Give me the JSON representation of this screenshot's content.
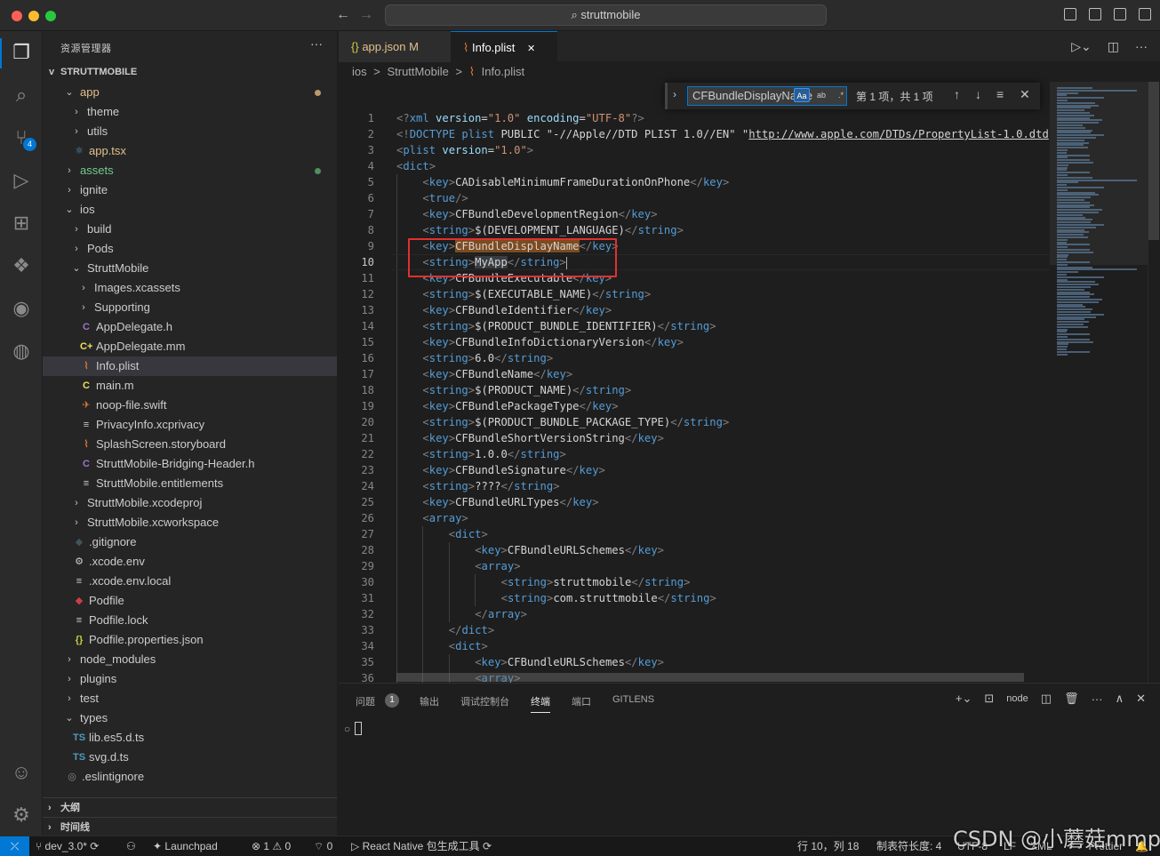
{
  "window": {
    "search_text": "struttmobile"
  },
  "sidebar": {
    "title": "资源管理器",
    "more": "···",
    "root_label": "STRUTTMOBILE",
    "tree": [
      {
        "label": "app",
        "chev": "v",
        "icon": "",
        "level": 1,
        "color": "#e2c08d",
        "dot": "#b89a6d"
      },
      {
        "label": "theme",
        "chev": ">",
        "icon": "",
        "level": 2,
        "color": "#cccccc"
      },
      {
        "label": "utils",
        "chev": ">",
        "icon": "",
        "level": 2,
        "color": "#cccccc"
      },
      {
        "label": "app.tsx",
        "chev": "",
        "icon": "⚛",
        "iconColor": "#519aba",
        "level": 2,
        "color": "#e2c08d"
      },
      {
        "label": "assets",
        "chev": ">",
        "icon": "",
        "level": 1,
        "color": "#73c991",
        "dot": "#4e8f5e"
      },
      {
        "label": "ignite",
        "chev": ">",
        "icon": "",
        "level": 1,
        "color": "#cccccc"
      },
      {
        "label": "ios",
        "chev": "v",
        "icon": "",
        "level": 1,
        "color": "#cccccc"
      },
      {
        "label": "build",
        "chev": ">",
        "icon": "",
        "level": 2,
        "color": "#cccccc"
      },
      {
        "label": "Pods",
        "chev": ">",
        "icon": "",
        "level": 2,
        "color": "#cccccc"
      },
      {
        "label": "StruttMobile",
        "chev": "v",
        "icon": "",
        "level": 2,
        "color": "#cccccc"
      },
      {
        "label": "Images.xcassets",
        "chev": ">",
        "icon": "",
        "level": 3,
        "color": "#cccccc"
      },
      {
        "label": "Supporting",
        "chev": ">",
        "icon": "",
        "level": 3,
        "color": "#cccccc"
      },
      {
        "label": "AppDelegate.h",
        "chev": "",
        "icon": "C",
        "iconColor": "#a074c4",
        "level": 3,
        "color": "#cccccc"
      },
      {
        "label": "AppDelegate.mm",
        "chev": "",
        "icon": "C+",
        "iconColor": "#f1e05a",
        "level": 3,
        "color": "#cccccc"
      },
      {
        "label": "Info.plist",
        "chev": "",
        "icon": "⌇",
        "iconColor": "#e37933",
        "level": 3,
        "color": "#cccccc",
        "selected": true
      },
      {
        "label": "main.m",
        "chev": "",
        "icon": "C",
        "iconColor": "#f1e05a",
        "level": 3,
        "color": "#cccccc"
      },
      {
        "label": "noop-file.swift",
        "chev": "",
        "icon": "✈",
        "iconColor": "#e37933",
        "level": 3,
        "color": "#cccccc"
      },
      {
        "label": "PrivacyInfo.xcprivacy",
        "chev": "",
        "icon": "≡",
        "iconColor": "#cccccc",
        "level": 3,
        "color": "#cccccc"
      },
      {
        "label": "SplashScreen.storyboard",
        "chev": "",
        "icon": "⌇",
        "iconColor": "#e37933",
        "level": 3,
        "color": "#cccccc"
      },
      {
        "label": "StruttMobile-Bridging-Header.h",
        "chev": "",
        "icon": "C",
        "iconColor": "#a074c4",
        "level": 3,
        "color": "#cccccc"
      },
      {
        "label": "StruttMobile.entitlements",
        "chev": "",
        "icon": "≡",
        "iconColor": "#cccccc",
        "level": 3,
        "color": "#cccccc"
      },
      {
        "label": "StruttMobile.xcodeproj",
        "chev": ">",
        "icon": "",
        "level": 2,
        "color": "#cccccc"
      },
      {
        "label": "StruttMobile.xcworkspace",
        "chev": ">",
        "icon": "",
        "level": 2,
        "color": "#cccccc"
      },
      {
        "label": ".gitignore",
        "chev": "",
        "icon": "◆",
        "iconColor": "#41535b",
        "level": 2,
        "color": "#cccccc"
      },
      {
        "label": ".xcode.env",
        "chev": "",
        "icon": "⚙",
        "iconColor": "#cccccc",
        "level": 2,
        "color": "#cccccc"
      },
      {
        "label": ".xcode.env.local",
        "chev": "",
        "icon": "≡",
        "iconColor": "#cccccc",
        "level": 2,
        "color": "#cccccc"
      },
      {
        "label": "Podfile",
        "chev": "",
        "icon": "◆",
        "iconColor": "#cc3e44",
        "level": 2,
        "color": "#cccccc"
      },
      {
        "label": "Podfile.lock",
        "chev": "",
        "icon": "≡",
        "iconColor": "#cccccc",
        "level": 2,
        "color": "#cccccc"
      },
      {
        "label": "Podfile.properties.json",
        "chev": "",
        "icon": "{}",
        "iconColor": "#cbcb41",
        "level": 2,
        "color": "#cccccc"
      },
      {
        "label": "node_modules",
        "chev": ">",
        "icon": "",
        "level": 1,
        "color": "#cccccc"
      },
      {
        "label": "plugins",
        "chev": ">",
        "icon": "",
        "level": 1,
        "color": "#cccccc"
      },
      {
        "label": "test",
        "chev": ">",
        "icon": "",
        "level": 1,
        "color": "#cccccc"
      },
      {
        "label": "types",
        "chev": "v",
        "icon": "",
        "level": 1,
        "color": "#cccccc"
      },
      {
        "label": "lib.es5.d.ts",
        "chev": "",
        "icon": "TS",
        "iconColor": "#519aba",
        "level": 2,
        "color": "#cccccc"
      },
      {
        "label": "svg.d.ts",
        "chev": "",
        "icon": "TS",
        "iconColor": "#519aba",
        "level": 2,
        "color": "#cccccc"
      },
      {
        "label": ".eslintignore",
        "chev": "",
        "icon": "◎",
        "iconColor": "#8a8a8a",
        "level": 1,
        "color": "#cccccc"
      }
    ],
    "outline_label": "大纲",
    "timeline_label": "时间线"
  },
  "tabs": [
    {
      "icon": "{}",
      "label": "app.json",
      "modified": "M",
      "active": false
    },
    {
      "icon": "⌇",
      "label": "Info.plist",
      "close": "✕",
      "active": true
    }
  ],
  "breadcrumb": [
    "ios",
    ">",
    "StruttMobile",
    ">",
    "Info.plist"
  ],
  "find": {
    "query": "CFBundleDisplayName",
    "opt_case": "Aa",
    "opt_word": "ab",
    "opt_regex": ".*",
    "result": "第 1 项，共 1 项"
  },
  "editor": {
    "current_line": 10,
    "lines": [
      {
        "n": 1,
        "indent": 0,
        "html": "<span class='brk'>&lt;?</span><span class='tag'>xml</span> <span class='attr'>version</span>=<span class='str'>\"1.0\"</span> <span class='attr'>encoding</span>=<span class='str'>\"UTF-8\"</span><span class='brk'>?&gt;</span>"
      },
      {
        "n": 2,
        "indent": 0,
        "html": "<span class='brk'>&lt;!</span><span class='tag'>DOCTYPE</span> <span class='tag'>plist</span> <span class='txt'>PUBLIC \"-//Apple//DTD PLIST 1.0//EN\" \"<span class='link'>http://www.apple.com/DTDs/PropertyList-1.0.dtd</span>\"</span><span class='brk'>&gt;</span>"
      },
      {
        "n": 3,
        "indent": 0,
        "html": "<span class='brk'>&lt;</span><span class='tag'>plist</span> <span class='attr'>version</span>=<span class='str'>\"1.0\"</span><span class='brk'>&gt;</span>"
      },
      {
        "n": 4,
        "indent": 0,
        "html": "<span class='brk'>&lt;</span><span class='tag'>dict</span><span class='brk'>&gt;</span>"
      },
      {
        "n": 5,
        "indent": 1,
        "html": "<span class='brk'>&lt;</span><span class='tag'>key</span><span class='brk'>&gt;</span>CADisableMinimumFrameDurationOnPhone<span class='brk'>&lt;/</span><span class='tag'>key</span><span class='brk'>&gt;</span>"
      },
      {
        "n": 6,
        "indent": 1,
        "html": "<span class='brk'>&lt;</span><span class='tag'>true</span><span class='brk'>/&gt;</span>"
      },
      {
        "n": 7,
        "indent": 1,
        "html": "<span class='brk'>&lt;</span><span class='tag'>key</span><span class='brk'>&gt;</span>CFBundleDevelopmentRegion<span class='brk'>&lt;/</span><span class='tag'>key</span><span class='brk'>&gt;</span>"
      },
      {
        "n": 8,
        "indent": 1,
        "html": "<span class='brk'>&lt;</span><span class='tag'>string</span><span class='brk'>&gt;</span>$(DEVELOPMENT_LANGUAGE)<span class='brk'>&lt;/</span><span class='tag'>string</span><span class='brk'>&gt;</span>"
      },
      {
        "n": 9,
        "indent": 1,
        "html": "<span class='brk'>&lt;</span><span class='tag'>key</span><span class='brk'>&gt;</span><span class='hl-find'>CFBundleDisplayName</span><span class='brk'>&lt;/</span><span class='tag'>key</span><span class='brk'>&gt;</span>"
      },
      {
        "n": 10,
        "indent": 1,
        "html": "<span class='brk'>&lt;</span><span class='tag'>string</span><span class='brk'>&gt;</span><span class='hl-sel'>MyApp</span><span class='brk'>&lt;/</span><span class='tag'>string</span><span class='brk'>&gt;</span><span class='cursor'></span>"
      },
      {
        "n": 11,
        "indent": 1,
        "html": "<span class='brk'>&lt;</span><span class='tag'>key</span><span class='brk'>&gt;</span>CFBundleExecutable<span class='brk'>&lt;/</span><span class='tag'>key</span><span class='brk'>&gt;</span>"
      },
      {
        "n": 12,
        "indent": 1,
        "html": "<span class='brk'>&lt;</span><span class='tag'>string</span><span class='brk'>&gt;</span>$(EXECUTABLE_NAME)<span class='brk'>&lt;/</span><span class='tag'>string</span><span class='brk'>&gt;</span>"
      },
      {
        "n": 13,
        "indent": 1,
        "html": "<span class='brk'>&lt;</span><span class='tag'>key</span><span class='brk'>&gt;</span>CFBundleIdentifier<span class='brk'>&lt;/</span><span class='tag'>key</span><span class='brk'>&gt;</span>"
      },
      {
        "n": 14,
        "indent": 1,
        "html": "<span class='brk'>&lt;</span><span class='tag'>string</span><span class='brk'>&gt;</span>$(PRODUCT_BUNDLE_IDENTIFIER)<span class='brk'>&lt;/</span><span class='tag'>string</span><span class='brk'>&gt;</span>"
      },
      {
        "n": 15,
        "indent": 1,
        "html": "<span class='brk'>&lt;</span><span class='tag'>key</span><span class='brk'>&gt;</span>CFBundleInfoDictionaryVersion<span class='brk'>&lt;/</span><span class='tag'>key</span><span class='brk'>&gt;</span>"
      },
      {
        "n": 16,
        "indent": 1,
        "html": "<span class='brk'>&lt;</span><span class='tag'>string</span><span class='brk'>&gt;</span>6.0<span class='brk'>&lt;/</span><span class='tag'>string</span><span class='brk'>&gt;</span>"
      },
      {
        "n": 17,
        "indent": 1,
        "html": "<span class='brk'>&lt;</span><span class='tag'>key</span><span class='brk'>&gt;</span>CFBundleName<span class='brk'>&lt;/</span><span class='tag'>key</span><span class='brk'>&gt;</span>"
      },
      {
        "n": 18,
        "indent": 1,
        "html": "<span class='brk'>&lt;</span><span class='tag'>string</span><span class='brk'>&gt;</span>$(PRODUCT_NAME)<span class='brk'>&lt;/</span><span class='tag'>string</span><span class='brk'>&gt;</span>"
      },
      {
        "n": 19,
        "indent": 1,
        "html": "<span class='brk'>&lt;</span><span class='tag'>key</span><span class='brk'>&gt;</span>CFBundlePackageType<span class='brk'>&lt;/</span><span class='tag'>key</span><span class='brk'>&gt;</span>"
      },
      {
        "n": 20,
        "indent": 1,
        "html": "<span class='brk'>&lt;</span><span class='tag'>string</span><span class='brk'>&gt;</span>$(PRODUCT_BUNDLE_PACKAGE_TYPE)<span class='brk'>&lt;/</span><span class='tag'>string</span><span class='brk'>&gt;</span>"
      },
      {
        "n": 21,
        "indent": 1,
        "html": "<span class='brk'>&lt;</span><span class='tag'>key</span><span class='brk'>&gt;</span>CFBundleShortVersionString<span class='brk'>&lt;/</span><span class='tag'>key</span><span class='brk'>&gt;</span>"
      },
      {
        "n": 22,
        "indent": 1,
        "html": "<span class='brk'>&lt;</span><span class='tag'>string</span><span class='brk'>&gt;</span>1.0.0<span class='brk'>&lt;/</span><span class='tag'>string</span><span class='brk'>&gt;</span>"
      },
      {
        "n": 23,
        "indent": 1,
        "html": "<span class='brk'>&lt;</span><span class='tag'>key</span><span class='brk'>&gt;</span>CFBundleSignature<span class='brk'>&lt;/</span><span class='tag'>key</span><span class='brk'>&gt;</span>"
      },
      {
        "n": 24,
        "indent": 1,
        "html": "<span class='brk'>&lt;</span><span class='tag'>string</span><span class='brk'>&gt;</span>????<span class='brk'>&lt;/</span><span class='tag'>string</span><span class='brk'>&gt;</span>"
      },
      {
        "n": 25,
        "indent": 1,
        "html": "<span class='brk'>&lt;</span><span class='tag'>key</span><span class='brk'>&gt;</span>CFBundleURLTypes<span class='brk'>&lt;/</span><span class='tag'>key</span><span class='brk'>&gt;</span>"
      },
      {
        "n": 26,
        "indent": 1,
        "html": "<span class='brk'>&lt;</span><span class='tag'>array</span><span class='brk'>&gt;</span>"
      },
      {
        "n": 27,
        "indent": 2,
        "html": "<span class='brk'>&lt;</span><span class='tag'>dict</span><span class='brk'>&gt;</span>"
      },
      {
        "n": 28,
        "indent": 3,
        "html": "<span class='brk'>&lt;</span><span class='tag'>key</span><span class='brk'>&gt;</span>CFBundleURLSchemes<span class='brk'>&lt;/</span><span class='tag'>key</span><span class='brk'>&gt;</span>"
      },
      {
        "n": 29,
        "indent": 3,
        "html": "<span class='brk'>&lt;</span><span class='tag'>array</span><span class='brk'>&gt;</span>"
      },
      {
        "n": 30,
        "indent": 4,
        "html": "<span class='brk'>&lt;</span><span class='tag'>string</span><span class='brk'>&gt;</span>struttmobile<span class='brk'>&lt;/</span><span class='tag'>string</span><span class='brk'>&gt;</span>"
      },
      {
        "n": 31,
        "indent": 4,
        "html": "<span class='brk'>&lt;</span><span class='tag'>string</span><span class='brk'>&gt;</span>com.struttmobile<span class='brk'>&lt;/</span><span class='tag'>string</span><span class='brk'>&gt;</span>"
      },
      {
        "n": 32,
        "indent": 3,
        "html": "<span class='brk'>&lt;/</span><span class='tag'>array</span><span class='brk'>&gt;</span>"
      },
      {
        "n": 33,
        "indent": 2,
        "html": "<span class='brk'>&lt;/</span><span class='tag'>dict</span><span class='brk'>&gt;</span>"
      },
      {
        "n": 34,
        "indent": 2,
        "html": "<span class='brk'>&lt;</span><span class='tag'>dict</span><span class='brk'>&gt;</span>"
      },
      {
        "n": 35,
        "indent": 3,
        "html": "<span class='brk'>&lt;</span><span class='tag'>key</span><span class='brk'>&gt;</span>CFBundleURLSchemes<span class='brk'>&lt;/</span><span class='tag'>key</span><span class='brk'>&gt;</span>"
      },
      {
        "n": 36,
        "indent": 3,
        "html": "<span class='brk'>&lt;</span><span class='tag'>array</span><span class='brk'>&gt;</span>"
      }
    ]
  },
  "panel": {
    "tabs": [
      "问题",
      "输出",
      "调试控制台",
      "终端",
      "端口",
      "GITLENS"
    ],
    "active_tab": "终端",
    "problems_count": "1",
    "shell": "node"
  },
  "statusbar": {
    "remote": "⤫",
    "branch": "dev_3.0*",
    "launchpad": "Launchpad",
    "errors": "1",
    "warnings": "0",
    "ports": "0",
    "rn_tool": "React Native 包生成工具",
    "position": "行 10，列 18",
    "tab_size": "制表符长度: 4",
    "encoding": "UTF-8",
    "eol": "LF",
    "lang": "XML",
    "prettier": "Prettier"
  },
  "watermark": "CSDN @小蘑菇mmp"
}
